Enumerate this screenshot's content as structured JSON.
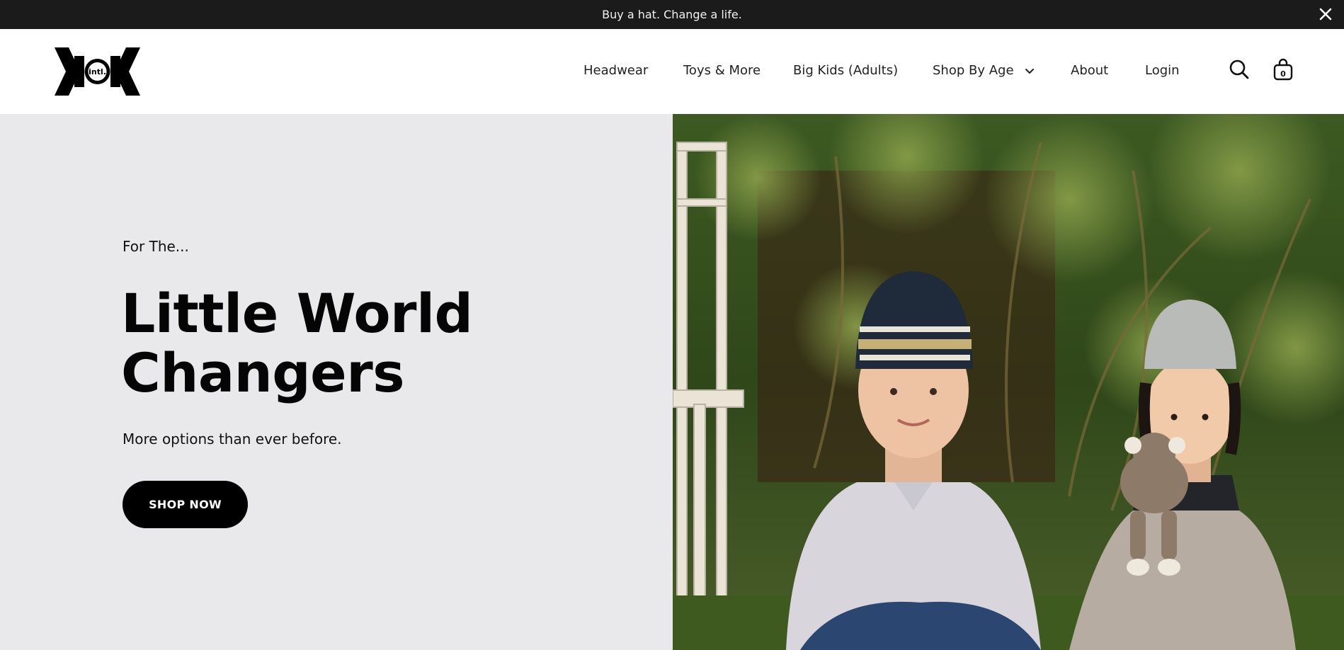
{
  "announcement": {
    "text": "Buy a hat. Change a life.",
    "close_icon": "close-icon"
  },
  "header": {
    "logo_text": "intl.",
    "nav": [
      {
        "label": "Headwear"
      },
      {
        "label": "Toys & More"
      },
      {
        "label": "Big Kids (Adults)"
      },
      {
        "label": "Shop By Age"
      },
      {
        "label": "About"
      },
      {
        "label": "Login"
      }
    ],
    "cart_count": "0",
    "icons": [
      "search-icon",
      "shopping-bag-icon",
      "chevron-down-icon"
    ]
  },
  "hero": {
    "eyebrow": "For The...",
    "headline_line1": "Little World",
    "headline_line2": "Changers",
    "subtext": "More options than ever before.",
    "cta_label": "SHOP NOW"
  },
  "colors": {
    "announcement_bg": "#1b1b1b",
    "hero_left_bg": "#e9e9eb",
    "cta_bg": "#000000"
  }
}
